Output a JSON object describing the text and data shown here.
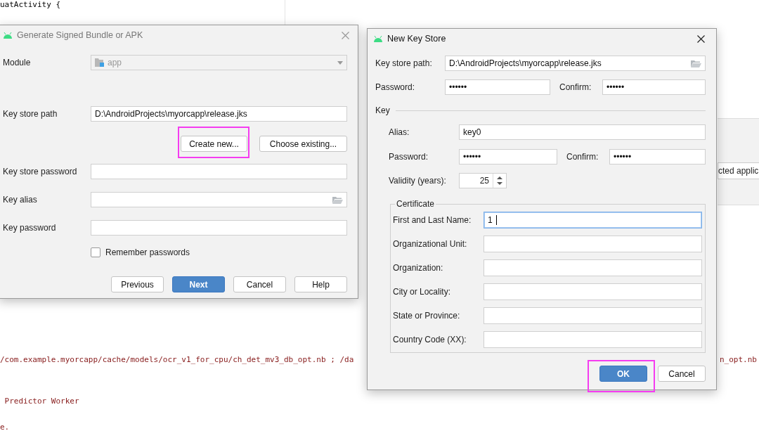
{
  "editor": {
    "lines": [
      {
        "text": "uatActivity {",
        "kind": "plain"
      },
      {
        "text": "/com.example.myorcapp/cache/models/ocr_v1_for_cpu/ch_det_mv3_db_opt.nb ; /da",
        "kind": "string"
      },
      {
        "text": " Predictor Worker",
        "kind": "string"
      },
      {
        "text": "e.",
        "kind": "string"
      }
    ],
    "right_fragment": "n_opt.nb"
  },
  "side_panel": {
    "field_value": "cted applic"
  },
  "generate_dialog": {
    "title": "Generate Signed Bundle or APK",
    "module": {
      "label": "Module",
      "value": "app",
      "disabled": true
    },
    "key_store_path": {
      "label": "Key store path",
      "value": "D:\\AndroidProjects\\myorcapp\\release.jks"
    },
    "path_buttons": [
      {
        "label": "Create new...",
        "highlighted": true
      },
      {
        "label": "Choose existing...",
        "highlighted": false
      }
    ],
    "fields": [
      {
        "label": "Key store password",
        "browse": false
      },
      {
        "label": "Key alias",
        "browse": true
      },
      {
        "label": "Key password",
        "browse": false
      }
    ],
    "remember": {
      "label": "Remember passwords",
      "checked": false
    },
    "buttons": [
      {
        "label": "Previous",
        "primary": false
      },
      {
        "label": "Next",
        "primary": true
      },
      {
        "label": "Cancel",
        "primary": false
      },
      {
        "label": "Help",
        "primary": false
      }
    ]
  },
  "key_store_dialog": {
    "title": "New Key Store",
    "path": {
      "label": "Key store path:",
      "value": "D:\\AndroidProjects\\myorcapp\\release.jks"
    },
    "password": {
      "label": "Password:",
      "value": "••••••",
      "confirm_label": "Confirm:",
      "confirm_value": "••••••"
    },
    "key": {
      "title": "Key",
      "alias": {
        "label": "Alias:",
        "value": "key0"
      },
      "password": {
        "label": "Password:",
        "value": "••••••",
        "confirm_label": "Confirm:",
        "confirm_value": "••••••"
      },
      "validity": {
        "label": "Validity (years):",
        "value": "25"
      },
      "certificate": {
        "title": "Certificate",
        "fields": [
          {
            "label": "First and Last Name:",
            "value": "1",
            "focused": true
          },
          {
            "label": "Organizational Unit:",
            "focused": false
          },
          {
            "label": "Organization:",
            "focused": false
          },
          {
            "label": "City or Locality:",
            "focused": false
          },
          {
            "label": "State or Province:",
            "focused": false
          },
          {
            "label": "Country Code (XX):",
            "focused": false
          }
        ]
      }
    },
    "buttons": [
      {
        "label": "OK",
        "primary": true,
        "highlighted": true
      },
      {
        "label": "Cancel",
        "primary": false,
        "highlighted": false
      }
    ]
  }
}
